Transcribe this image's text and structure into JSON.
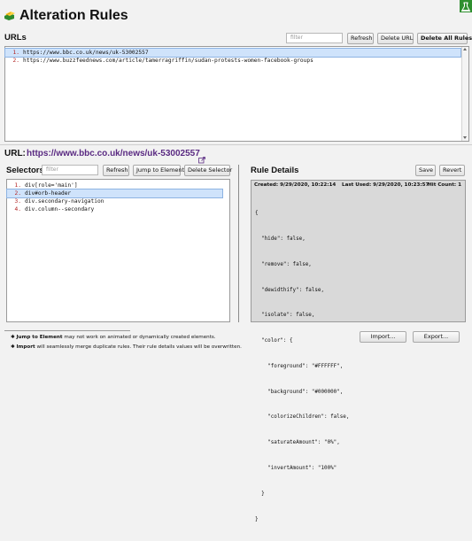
{
  "header": {
    "title": "Alteration Rules"
  },
  "urls": {
    "heading": "URLs",
    "filter_placeholder": "filter",
    "refresh_label": "Refresh",
    "delete_label": "Delete URL",
    "delete_all_label": "Delete All Rules!",
    "items": [
      {
        "num": "1.",
        "text": "https://www.bbc.co.uk/news/uk-53002557"
      },
      {
        "num": "2.",
        "text": "https://www.buzzfeednews.com/article/tamerragriffin/sudan-protests-women-facebook-groups"
      }
    ]
  },
  "current_url": {
    "label": "URL:",
    "value": "https://www.bbc.co.uk/news/uk-53002557"
  },
  "selectors": {
    "heading": "Selectors",
    "filter_placeholder": "filter",
    "refresh_label": "Refresh",
    "jump_label": "Jump to Element",
    "delete_label": "Delete Selector",
    "items": [
      {
        "num": "1.",
        "text": "div[role='main']"
      },
      {
        "num": "2.",
        "text": "div#orb-header"
      },
      {
        "num": "3.",
        "text": "div.secondary-navigation"
      },
      {
        "num": "4.",
        "text": "div.column--secondary"
      }
    ]
  },
  "rule_details": {
    "heading": "Rule Details",
    "save_label": "Save",
    "revert_label": "Revert",
    "created": "Created: 9/29/2020, 10:22:14",
    "last_used": "Last Used: 9/29/2020, 10:23:57",
    "hit_count": "Hit Count: 1",
    "json_lines": [
      "{",
      "  \"hide\": false,",
      "  \"remove\": false,",
      "  \"dewidthify\": false,",
      "  \"isolate\": false,",
      "  \"color\": {",
      "    \"foreground\": \"#FFFFFF\",",
      "    \"background\": \"#000000\",",
      "    \"colorizeChildren\": false,",
      "    \"saturateAmount\": \"0%\",",
      "    \"invertAmount\": \"100%\"",
      "  }",
      "}"
    ]
  },
  "footer": {
    "note1_bold": "Jump to Element",
    "note1_rest": " may not work on animated or dynamically created elements.",
    "note2_bold": "Import",
    "note2_rest": " will seamlessly merge duplicate rules. Their rule details values will be overwritten.",
    "import_label": "Import...",
    "export_label": "Export..."
  },
  "colors": {
    "url_link": "#5a2a82",
    "list_number": "#b02020",
    "selected_bg": "#cfe3fb"
  }
}
